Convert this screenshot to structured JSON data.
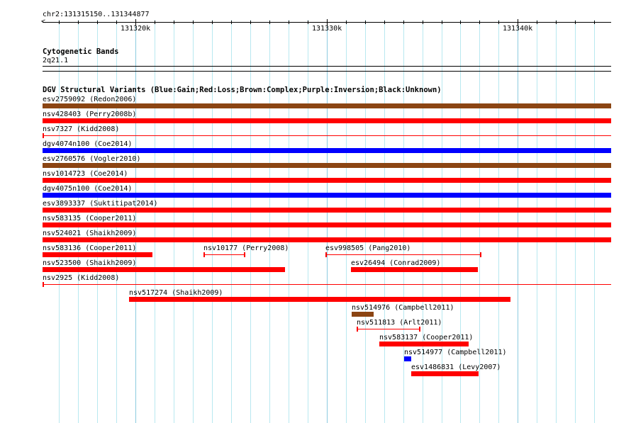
{
  "ruler": {
    "location": "chr2:131315150..131344877",
    "start": 131315150,
    "end": 131344877,
    "labels": [
      {
        "pos": 131320000,
        "text": "131320k"
      },
      {
        "pos": 131330000,
        "text": "131330k"
      },
      {
        "pos": 131340000,
        "text": "131340k"
      }
    ]
  },
  "cytoband": {
    "title": "Cytogenetic Bands",
    "band": "2q21.1"
  },
  "dgv": {
    "title": "DGV Structural Variants (Blue:Gain;Red:Loss;Brown:Complex;Purple:Inversion;Black:Unknown)",
    "colors": {
      "gain": "#0000ff",
      "loss": "#ff0000",
      "complex": "#8b4513"
    },
    "features": [
      {
        "label": "esv2759092 (Redon2006)",
        "row": 0,
        "start": 131315150,
        "end": 131344877,
        "type": "complex",
        "style": "thick"
      },
      {
        "label": "nsv428403 (Perry2008b)",
        "row": 1,
        "start": 131315150,
        "end": 131344877,
        "type": "loss",
        "style": "thick"
      },
      {
        "label": "nsv7327 (Kidd2008)",
        "row": 2,
        "start": 131315150,
        "end": 131344877,
        "type": "loss",
        "style": "thin"
      },
      {
        "label": "dgv4074n100 (Coe2014)",
        "row": 3,
        "start": 131315150,
        "end": 131344877,
        "type": "gain",
        "style": "thick"
      },
      {
        "label": "esv2760576 (Vogler2010)",
        "row": 4,
        "start": 131315150,
        "end": 131344877,
        "type": "complex",
        "style": "thick"
      },
      {
        "label": "nsv1014723 (Coe2014)",
        "row": 5,
        "start": 131315150,
        "end": 131344877,
        "type": "loss",
        "style": "thick"
      },
      {
        "label": "dgv4075n100 (Coe2014)",
        "row": 6,
        "start": 131315150,
        "end": 131344877,
        "type": "gain",
        "style": "thick"
      },
      {
        "label": "esv3893337 (Suktitipat2014)",
        "row": 7,
        "start": 131315150,
        "end": 131344877,
        "type": "loss",
        "style": "thick"
      },
      {
        "label": "nsv583135 (Cooper2011)",
        "row": 8,
        "start": 131315150,
        "end": 131344877,
        "type": "loss",
        "style": "thick"
      },
      {
        "label": "nsv524021 (Shaikh2009)",
        "row": 9,
        "start": 131315150,
        "end": 131344877,
        "type": "loss",
        "style": "thick"
      },
      {
        "label": "nsv583136 (Cooper2011)",
        "row": 10,
        "start": 131315150,
        "end": 131320896,
        "type": "loss",
        "style": "thick"
      },
      {
        "label": "nsv10177 (Perry2008)",
        "row": 10,
        "start": 131323565,
        "end": 131325715,
        "type": "loss",
        "style": "thin"
      },
      {
        "label": "esv998505 (Pang2010)",
        "row": 10,
        "start": 131329941,
        "end": 131338060,
        "type": "loss",
        "style": "thin"
      },
      {
        "label": "nsv523500 (Shaikh2009)",
        "row": 11,
        "start": 131315150,
        "end": 131327828,
        "type": "loss",
        "style": "thick"
      },
      {
        "label": "esv26494 (Conrad2009)",
        "row": 11,
        "start": 131331276,
        "end": 131337912,
        "type": "loss",
        "style": "thick"
      },
      {
        "label": "nsv2925 (Kidd2008)",
        "row": 12,
        "start": 131315150,
        "end": 131344877,
        "type": "loss",
        "style": "thin"
      },
      {
        "label": "nsv517274 (Shaikh2009)",
        "row": 13,
        "start": 131319673,
        "end": 131339616,
        "type": "loss",
        "style": "thick"
      },
      {
        "label": "nsv514976 (Campbell2011)",
        "row": 14,
        "start": 131331313,
        "end": 131332462,
        "type": "complex",
        "style": "thick"
      },
      {
        "label": "nsv511813 (Arlt2011)",
        "row": 15,
        "start": 131331572,
        "end": 131334871,
        "type": "loss",
        "style": "thin"
      },
      {
        "label": "nsv583137 (Cooper2011)",
        "row": 16,
        "start": 131332758,
        "end": 131337429,
        "type": "loss",
        "style": "thick"
      },
      {
        "label": "nsv514977 (Campbell2011)",
        "row": 17,
        "start": 131334055,
        "end": 131334426,
        "type": "gain",
        "style": "thick"
      },
      {
        "label": "esv1486831 (Levy2007)",
        "row": 18,
        "start": 131334426,
        "end": 131337949,
        "type": "loss",
        "style": "thick"
      }
    ]
  }
}
